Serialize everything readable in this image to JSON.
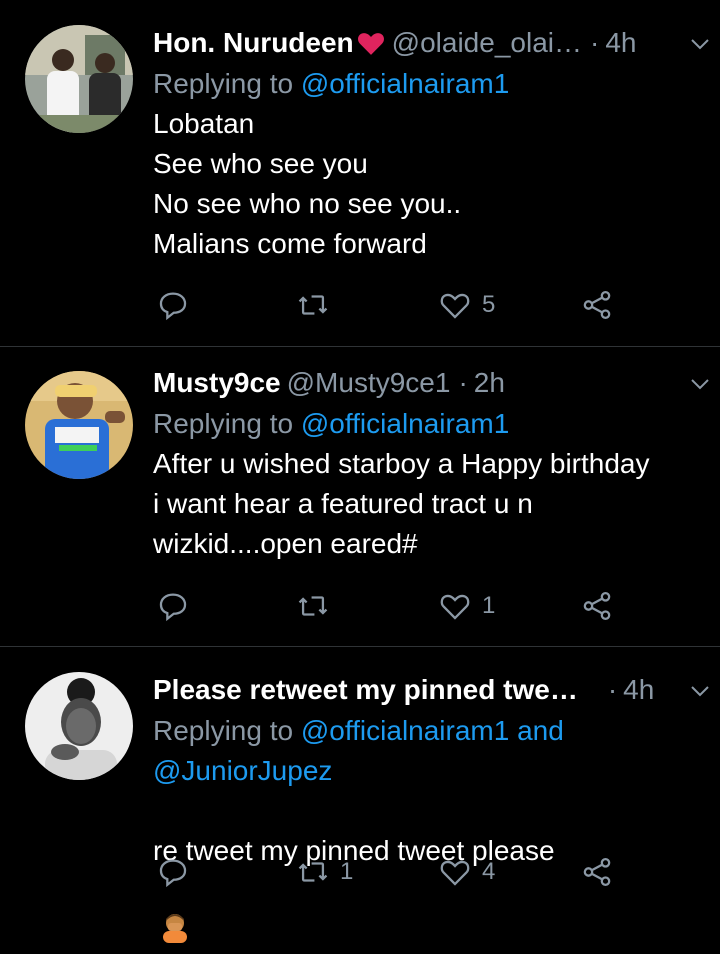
{
  "tweets": [
    {
      "name": "Hon. Nurudeen",
      "name_emoji": "heart-emoji",
      "handle": "@olaide_olai…",
      "dot": "·",
      "time": "4h",
      "replying_prefix": "Replying to",
      "mentions": [
        "@officialnairam1"
      ],
      "mention_joiner": "",
      "body": "Lobatan\nSee who see you\nNo see who no see you..\nMalians come forward",
      "reply_count": "",
      "retweet_count": "",
      "like_count": "5"
    },
    {
      "name": "Musty9ce",
      "handle": "@Musty9ce1",
      "dot": "·",
      "time": "2h",
      "replying_prefix": "Replying to",
      "mentions": [
        "@officialnairam1"
      ],
      "mention_joiner": "",
      "body": "After u wished starboy a Happy birthday\ni want hear a featured tract u n\nwizkid....open eared#",
      "reply_count": "",
      "retweet_count": "",
      "like_count": "1"
    },
    {
      "name": "Please retweet my pinned twe…",
      "handle": "",
      "dot": "·",
      "time": "4h",
      "replying_prefix": "Replying to",
      "mentions": [
        "@officialnairam1",
        "@JuniorJupez"
      ],
      "mention_joiner": "and",
      "body": "re tweet my pinned tweet please",
      "body_emoji": "person-facepalming-emoji",
      "reply_count": "",
      "retweet_count": "1",
      "like_count": "4"
    }
  ],
  "colors": {
    "background": "#000000",
    "text": "#ffffff",
    "secondary": "#8b98a5",
    "link": "#1d9bf0",
    "divider": "#2f3336",
    "heart": "#e0245e"
  }
}
